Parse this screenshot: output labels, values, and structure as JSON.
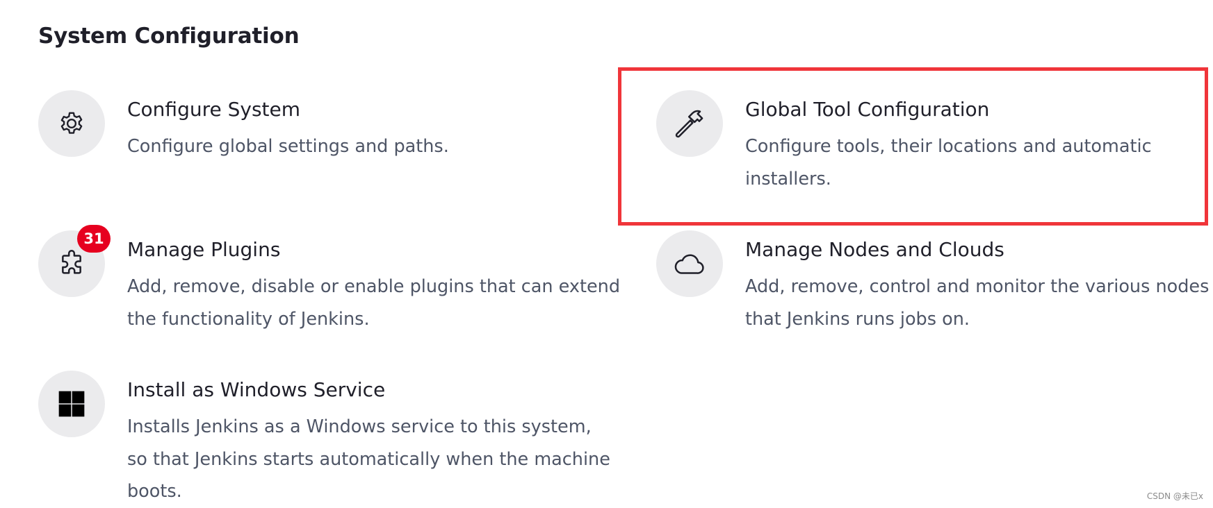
{
  "section": {
    "title": "System Configuration"
  },
  "items": [
    {
      "title": "Configure System",
      "description": "Configure global settings and paths.",
      "icon": "gear-icon"
    },
    {
      "title": "Global Tool Configuration",
      "description": "Configure tools, their locations and automatic installers.",
      "icon": "hammer-icon",
      "highlighted": true,
      "highlight_color": "#f0353a"
    },
    {
      "title": "Manage Plugins",
      "description": "Add, remove, disable or enable plugins that can extend the functionality of Jenkins.",
      "icon": "puzzle-icon",
      "badge": "31",
      "badge_color": "#e6001f"
    },
    {
      "title": "Manage Nodes and Clouds",
      "description": "Add, remove, control and monitor the various nodes that Jenkins runs jobs on.",
      "icon": "cloud-icon"
    },
    {
      "title": "Install as Windows Service",
      "description": "Installs Jenkins as a Windows service to this system, so that Jenkins starts automatically when the machine boots.",
      "icon": "windows-icon"
    }
  ],
  "watermark": "CSDN @未已x",
  "colors": {
    "icon_background": "#ebebed",
    "title_text": "#1f1f29",
    "description_text": "#4e5566"
  }
}
